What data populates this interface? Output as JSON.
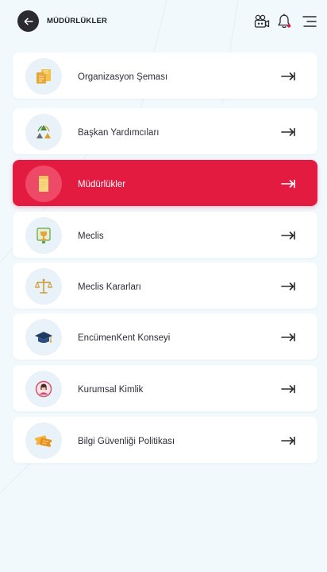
{
  "header": {
    "title": "MÜDÜRLÜKLER",
    "back_icon": "arrow-left-icon",
    "icons": [
      "video-camera-icon",
      "bell-icon",
      "menu-icon"
    ],
    "notification_dot_color": "#e31b41"
  },
  "colors": {
    "background": "#f2f9fd",
    "active_card": "#e31b41",
    "icon_circle": "#e8f2f8",
    "text": "#2d2d38"
  },
  "menu": {
    "items": [
      {
        "label": "Organizasyon Şeması",
        "icon": "org-chart-icon",
        "active": false
      },
      {
        "label": "Başkan Yardımcıları",
        "icon": "recycle-icon",
        "active": false
      },
      {
        "label": "Müdürlükler",
        "icon": "folder-icon",
        "active": true
      },
      {
        "label": "Meclis",
        "icon": "trophy-icon",
        "active": false
      },
      {
        "label": "Meclis Kararları",
        "icon": "scales-icon",
        "active": false
      },
      {
        "label": "EncümenKent Konseyi",
        "icon": "graduation-cap-icon",
        "active": false
      },
      {
        "label": "Kurumsal Kimlik",
        "icon": "person-badge-icon",
        "active": false
      },
      {
        "label": "Bilgi Güvenliği Politikası",
        "icon": "tickets-icon",
        "active": false
      }
    ]
  }
}
